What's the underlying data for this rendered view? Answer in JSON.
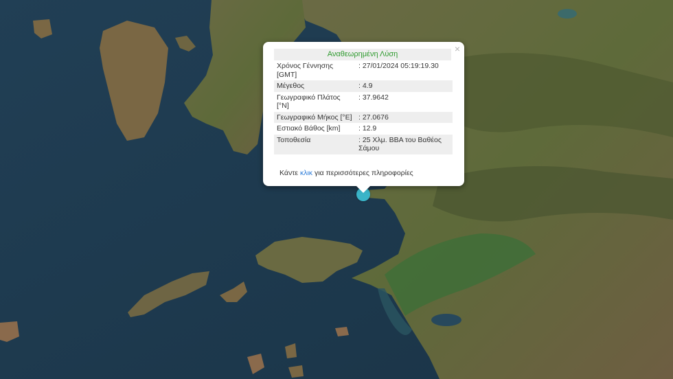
{
  "popup": {
    "title": "Αναθεωρημένη Λύση",
    "close_symbol": "×",
    "rows": [
      {
        "label": "Χρόνος Γέννησης [GMT]",
        "value": ": 27/01/2024 05:19:19.30"
      },
      {
        "label": "Μέγεθος",
        "value": ": 4.9"
      },
      {
        "label": "Γεωγραφικό Πλάτος [°N]",
        "value": ": 37.9642"
      },
      {
        "label": "Γεωγραφικό Μήκος [°E]",
        "value": ": 27.0676"
      },
      {
        "label": "Εστιακό Βάθος [km]",
        "value": ": 12.9"
      },
      {
        "label": "Τοποθεσία",
        "value": ": 25 Χλμ. ΒΒΑ του Βαθέος Σάμου"
      }
    ],
    "more_prefix": "Κάντε ",
    "more_link": "κλικ",
    "more_suffix": " για περισσότερες πληροφορίες"
  },
  "marker": {
    "name": "earthquake-epicenter-marker",
    "color": "#3ab4c8"
  },
  "map": {
    "sea_color": "#1e3a4e",
    "land_color": "#5b6a3c"
  }
}
